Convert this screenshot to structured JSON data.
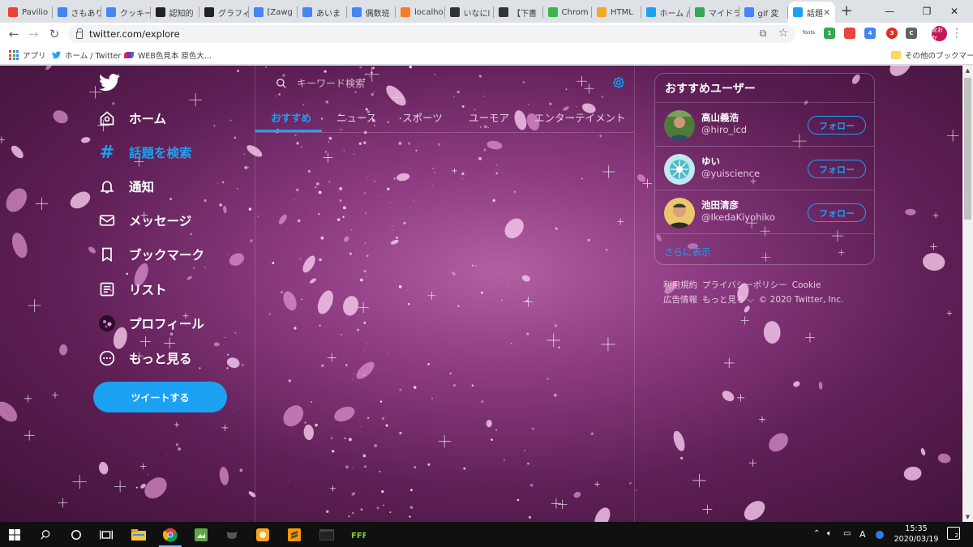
{
  "browser": {
    "tabs": [
      {
        "title": "Pavilio",
        "icon": "maps-pin-icon",
        "color": "#ea4335"
      },
      {
        "title": "さもあり",
        "icon": "google-icon",
        "color": "#4285f4"
      },
      {
        "title": "クッキー",
        "icon": "google-icon",
        "color": "#4285f4"
      },
      {
        "title": "認知的",
        "icon": "wikipedia-icon",
        "color": "#222222"
      },
      {
        "title": "グラフィ",
        "icon": "g-icon",
        "color": "#222222"
      },
      {
        "title": "[Zawg",
        "icon": "google-icon",
        "color": "#4285f4"
      },
      {
        "title": "あいま",
        "icon": "google-icon",
        "color": "#4285f4"
      },
      {
        "title": "偶数班",
        "icon": "google-icon",
        "color": "#4285f4"
      },
      {
        "title": "localho",
        "icon": "xampp-icon",
        "color": "#fb7a24"
      },
      {
        "title": "いなにl",
        "icon": "info-icon",
        "color": "#333333"
      },
      {
        "title": "【下書",
        "icon": "info-icon",
        "color": "#333333"
      },
      {
        "title": "Chrom",
        "icon": "chrome-icon",
        "color": "#3bb54a"
      },
      {
        "title": "HTML",
        "icon": "ti-icon",
        "color": "#f5a623"
      },
      {
        "title": "ホーム /",
        "icon": "twitter-icon",
        "color": "#1da1f2"
      },
      {
        "title": "マイドラ",
        "icon": "drive-icon",
        "color": "#34a853"
      },
      {
        "title": "gif 変",
        "icon": "google-icon",
        "color": "#4285f4"
      },
      {
        "title": "話題",
        "icon": "twitter-icon",
        "color": "#1da1f2",
        "active": true
      }
    ],
    "new_tab": "+",
    "window_controls": {
      "minimize": "—",
      "maximize": "❐",
      "close": "✕"
    },
    "url": "twitter.com/explore",
    "nav": {
      "back": "←",
      "forward": "→",
      "reload": "↻"
    },
    "profile_initials": "龙おか",
    "ext_fonts_label": "fonts",
    "ext_badges": [
      "1",
      "4",
      "3"
    ],
    "bookmarks": [
      {
        "label": "アプリ",
        "icon": "apps-grid-icon"
      },
      {
        "label": "ホーム / Twitter",
        "icon": "twitter-icon"
      },
      {
        "label": "WEB色見本 原色大...",
        "icon": "colors-icon"
      }
    ],
    "other_bookmarks": "その他のブックマーク"
  },
  "twitter": {
    "nav": [
      {
        "label": "ホーム",
        "icon": "home-icon"
      },
      {
        "label": "話題を検索",
        "icon": "hashtag-icon",
        "active": true
      },
      {
        "label": "通知",
        "icon": "bell-icon"
      },
      {
        "label": "メッセージ",
        "icon": "mail-icon"
      },
      {
        "label": "ブックマーク",
        "icon": "bookmark-icon"
      },
      {
        "label": "リスト",
        "icon": "list-icon"
      },
      {
        "label": "プロフィール",
        "icon": "profile-avatar-icon"
      },
      {
        "label": "もっと見る",
        "icon": "more-icon"
      }
    ],
    "tweet_button": "ツイートする",
    "search_placeholder": "キーワード検索",
    "tabs": [
      "おすすめ",
      "ニュース",
      "スポーツ",
      "ユーモア",
      "エンターテイメント"
    ],
    "active_tab": "おすすめ",
    "reco": {
      "title": "おすすめユーザー",
      "users": [
        {
          "name": "高山義浩",
          "handle": "@hiro_icd",
          "follow": "フォロー"
        },
        {
          "name": "ゆい",
          "handle": "@yuiscience",
          "follow": "フォロー"
        },
        {
          "name": "池田清彦",
          "handle": "@IkedaKiyohiko",
          "follow": "フォロー"
        }
      ],
      "show_more": "さらに表示"
    },
    "footer": {
      "terms": "利用規約",
      "privacy": "プライバシーポリシー",
      "cookie": "Cookie",
      "ads": "広告情報",
      "more": "もっと見る ⌵",
      "copyright": "© 2020 Twitter, Inc."
    },
    "accent_color": "#1da1f2"
  },
  "taskbar": {
    "time": "15:35",
    "date": "2020/03/19",
    "ime": "A",
    "notifications": "2"
  }
}
